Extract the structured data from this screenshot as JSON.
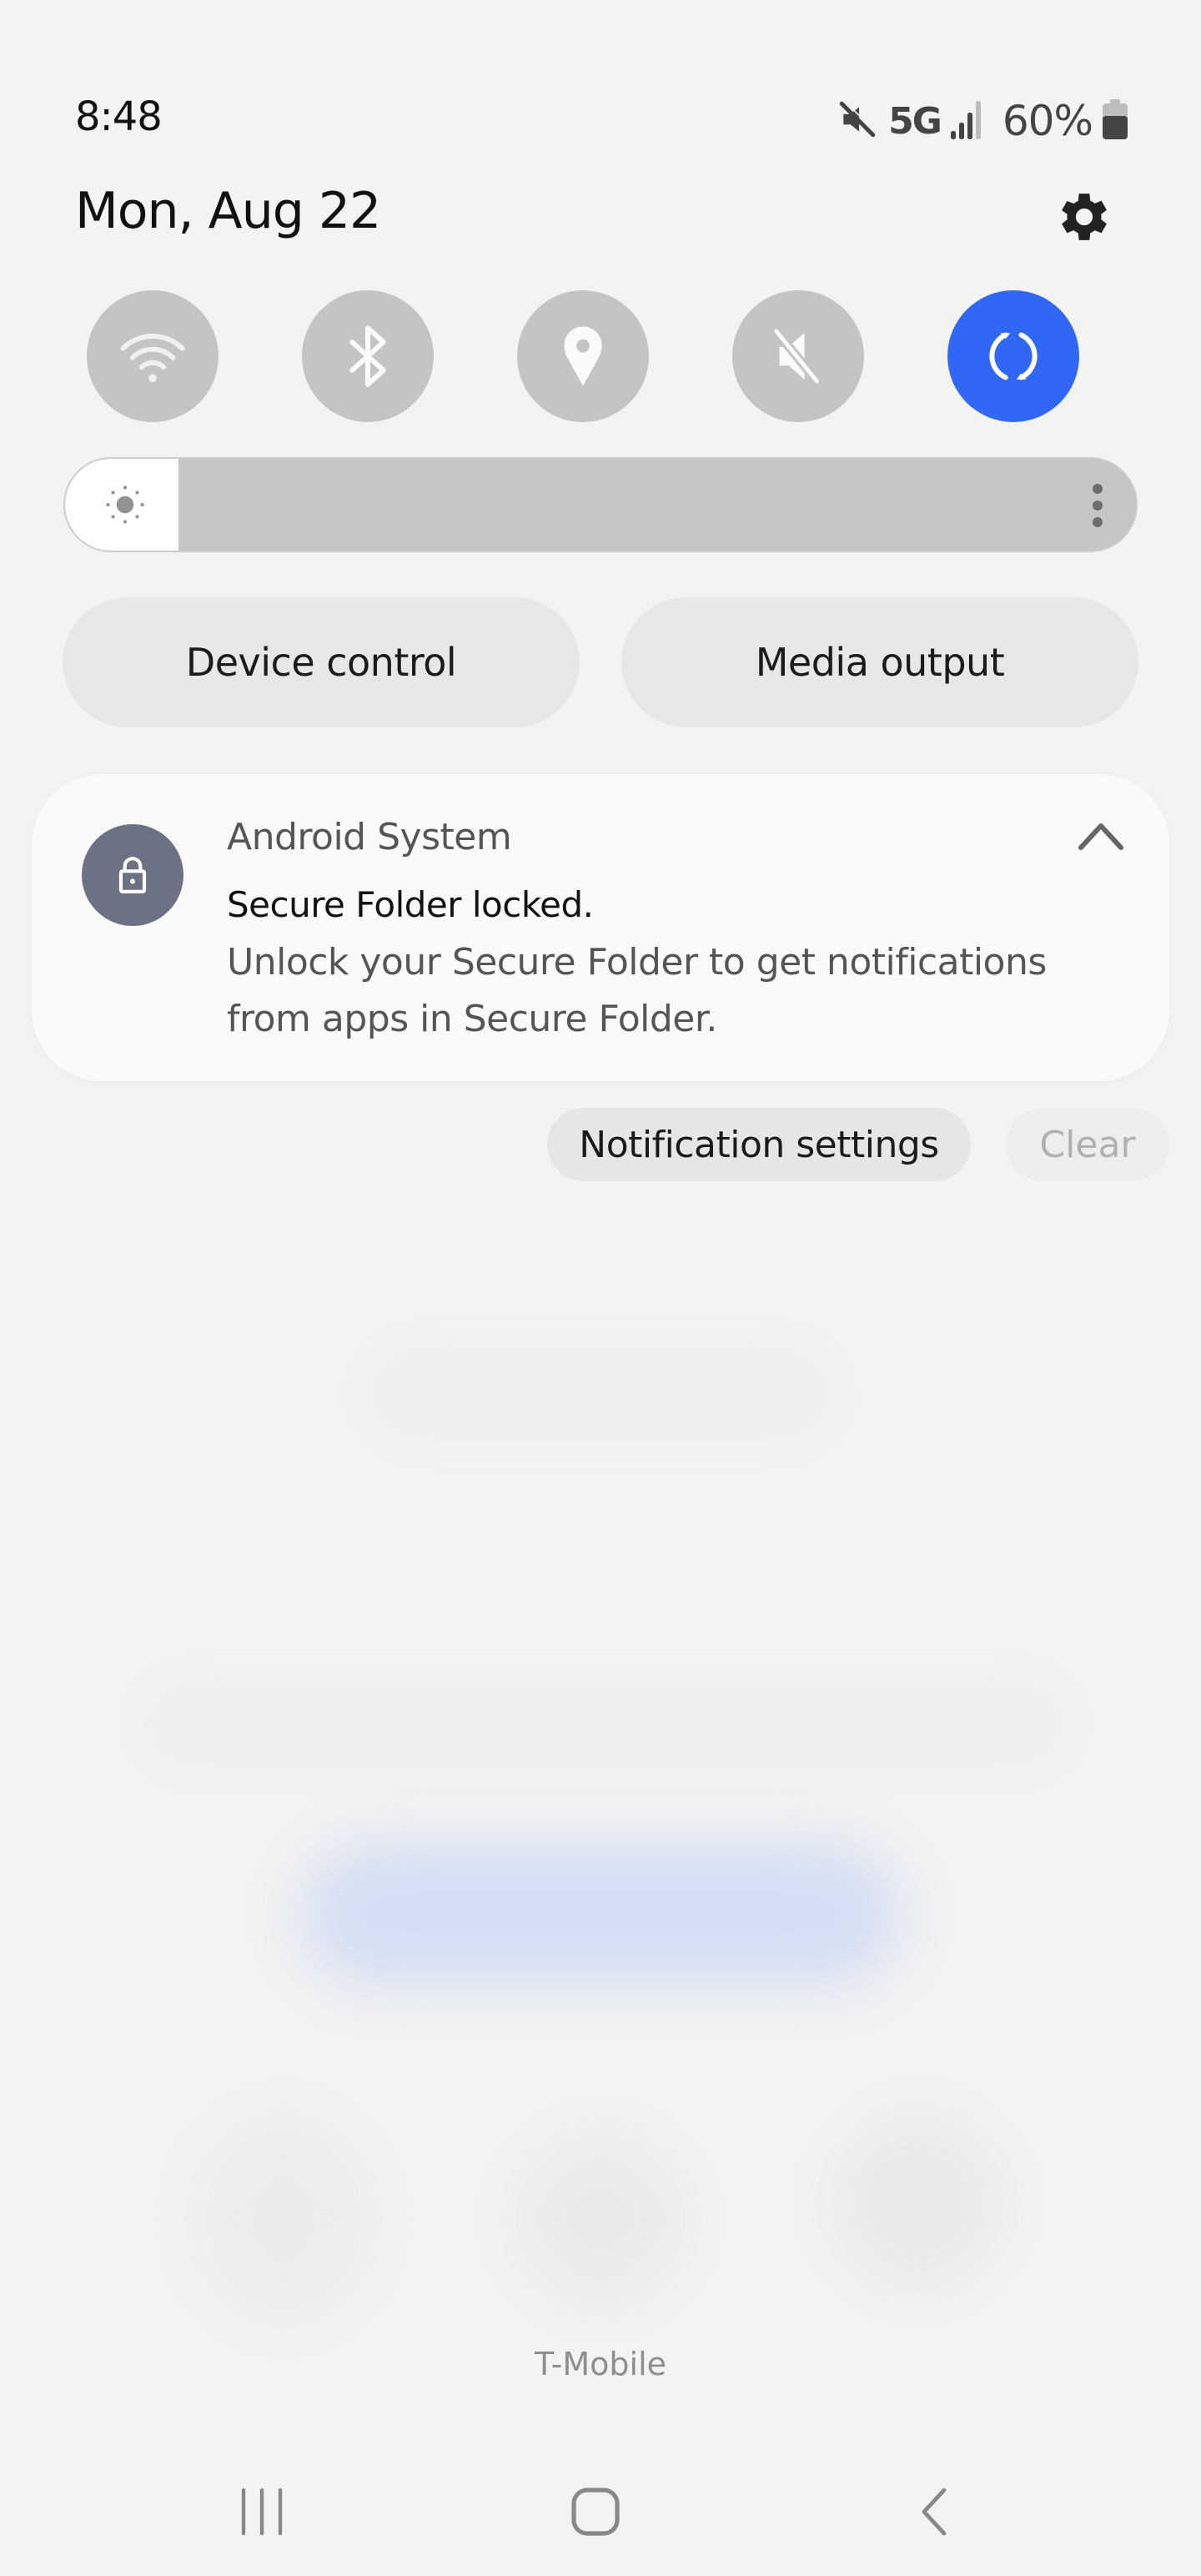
{
  "status_bar": {
    "time": "8:48",
    "network": "5G",
    "battery_percent_label": "60%",
    "battery_level": 0.6,
    "signal_bars": 3,
    "signal_bars_total": 4,
    "icons": [
      "mute-icon",
      "signal-icon",
      "battery-icon"
    ]
  },
  "header": {
    "date": "Mon, Aug 22",
    "settings_icon": "gear-icon"
  },
  "quick_toggles": [
    {
      "name": "wifi",
      "icon": "wifi-icon",
      "active": false
    },
    {
      "name": "bluetooth",
      "icon": "bluetooth-icon",
      "active": false
    },
    {
      "name": "location",
      "icon": "location-icon",
      "active": false
    },
    {
      "name": "sound",
      "icon": "mute-icon",
      "active": false
    },
    {
      "name": "auto-rotate",
      "icon": "rotate-icon",
      "active": true
    }
  ],
  "brightness": {
    "level": 0.0,
    "icon": "sun-icon",
    "more_icon": "more-vertical-icon"
  },
  "buttons": {
    "device_control": "Device control",
    "media_output": "Media output"
  },
  "notification": {
    "app_name": "Android System",
    "title": "Secure Folder locked.",
    "body": "Unlock your Secure Folder to get notifications from apps in Secure Folder.",
    "icon": "lock-icon",
    "expanded": true
  },
  "notification_actions": {
    "settings": "Notification settings",
    "clear": "Clear"
  },
  "carrier": "T-Mobile",
  "colors": {
    "accent": "#3167f6",
    "toggle_inactive": "#c4c4c4",
    "background": "#f3f3f3",
    "app_icon_bg": "#6c7184"
  }
}
